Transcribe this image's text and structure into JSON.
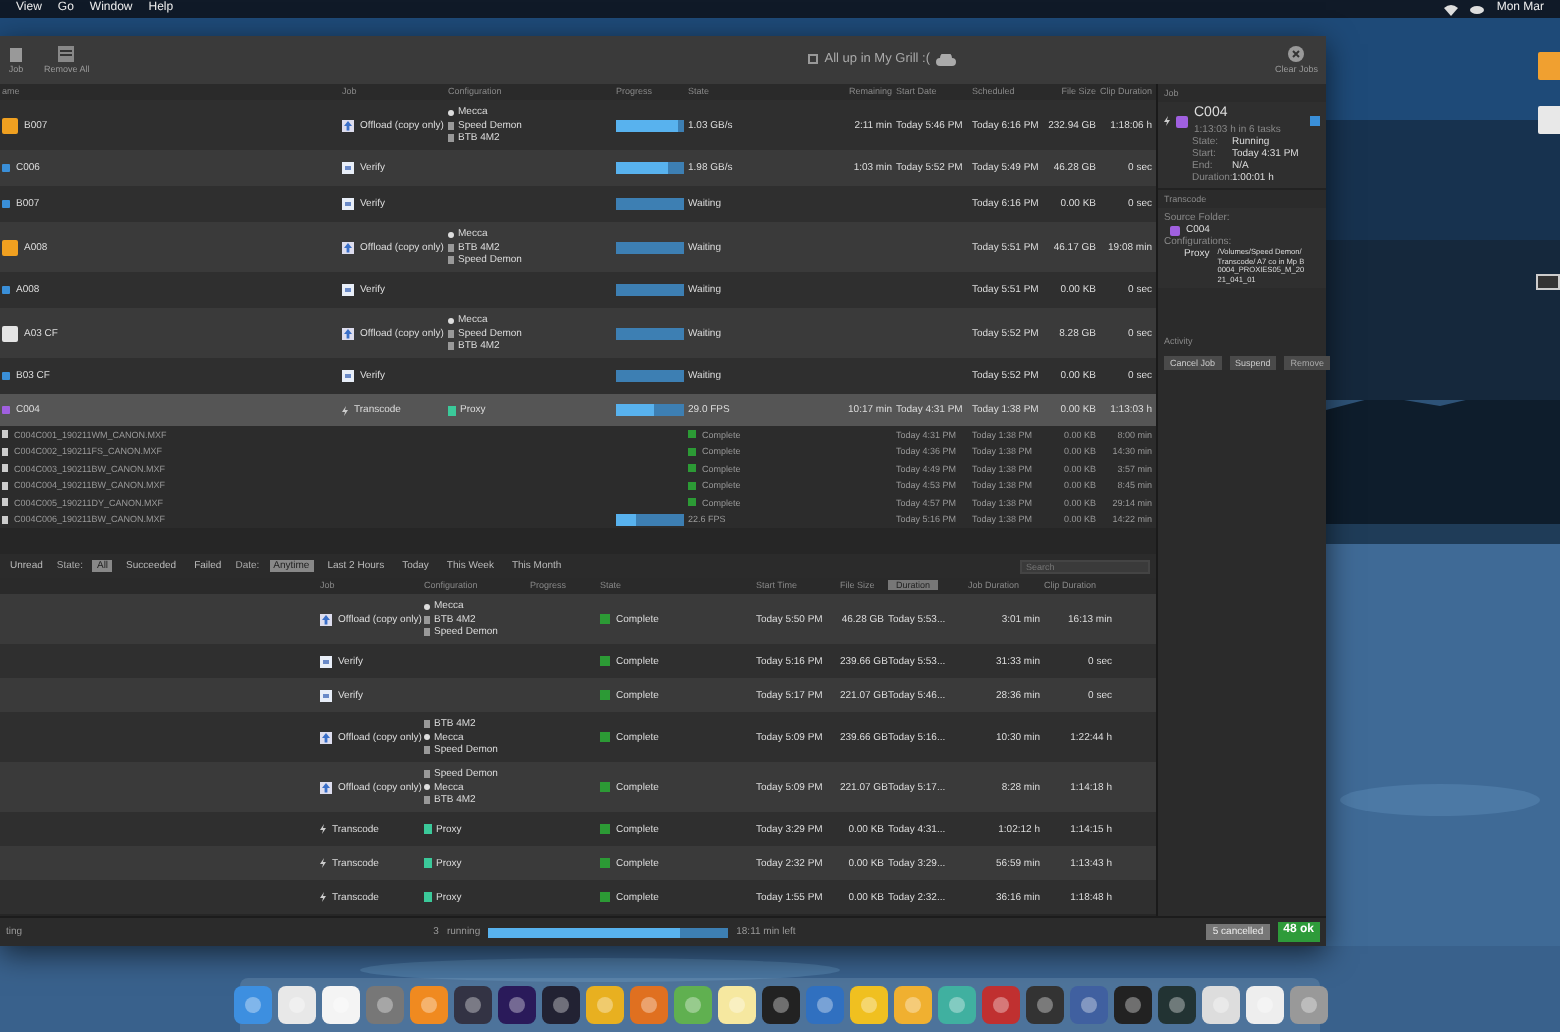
{
  "menu_bar": {
    "items": [
      "View",
      "Go",
      "Window",
      "Help"
    ],
    "clock": "Mon Mar"
  },
  "toolbar": {
    "buttons": [
      "Job",
      "Remove All"
    ],
    "title": "All up in My Grill :(",
    "clear": "Clear Jobs"
  },
  "queue": {
    "columns": [
      "ame",
      "Job",
      "Configuration",
      "Progress",
      "State",
      "Remaining",
      "Start Date",
      "Scheduled",
      "File Size",
      "Clip Duration"
    ],
    "rows": [
      {
        "name": "B007",
        "kind": "offload",
        "color": "#f0a020",
        "job": "Offload (copy only)",
        "destinations": [
          {
            "name": "Mecca",
            "kind": "network"
          },
          {
            "name": "Speed Demon",
            "kind": "drive"
          },
          {
            "name": "BTB 4M2",
            "kind": "drive"
          }
        ],
        "level": 0.9,
        "state": "1.03 GB/s",
        "remaining": "2:11 min",
        "start": "Today 5:46 PM",
        "scheduled": "Today 6:16 PM",
        "size": "232.94 GB",
        "duration": "1:18:06 h",
        "selected": false
      },
      {
        "name": "C006",
        "kind": "verify",
        "color": "#3a8fd8",
        "job": "Verify",
        "destinations": [],
        "level": 0.75,
        "state": "1.98 GB/s",
        "remaining": "1:03 min",
        "start": "Today 5:52 PM",
        "scheduled": "Today 5:49 PM",
        "size": "46.28 GB",
        "duration": "0 sec",
        "selected": false
      },
      {
        "name": "B007",
        "kind": "verify",
        "color": "#3a8fd8",
        "job": "Verify",
        "destinations": [],
        "state": "Waiting",
        "scheduled": "Today 6:16 PM",
        "size": "0.00 KB",
        "duration": "0 sec",
        "selected": false
      },
      {
        "name": "A008",
        "kind": "offload",
        "color": "#f0a020",
        "job": "Offload (copy only)",
        "destinations": [
          {
            "name": "Mecca",
            "kind": "network"
          },
          {
            "name": "BTB 4M2",
            "kind": "drive"
          },
          {
            "name": "Speed Demon",
            "kind": "drive"
          }
        ],
        "state": "Waiting",
        "scheduled": "Today 5:51 PM",
        "size": "46.17 GB",
        "duration": "19:08 min",
        "selected": false
      },
      {
        "name": "A008",
        "kind": "verify",
        "color": "#3a8fd8",
        "job": "Verify",
        "destinations": [],
        "state": "Waiting",
        "scheduled": "Today 5:51 PM",
        "size": "0.00 KB",
        "duration": "0 sec",
        "selected": false
      },
      {
        "name": "A03 CF",
        "kind": "offload",
        "color": "#e4e4e4",
        "job": "Offload (copy only)",
        "destinations": [
          {
            "name": "Mecca",
            "kind": "network"
          },
          {
            "name": "Speed Demon",
            "kind": "drive"
          },
          {
            "name": "BTB 4M2",
            "kind": "drive"
          }
        ],
        "state": "Waiting",
        "scheduled": "Today 5:52 PM",
        "size": "8.28 GB",
        "duration": "0 sec",
        "selected": false
      },
      {
        "name": "B03 CF",
        "kind": "verify",
        "color": "#3a8fd8",
        "job": "Verify",
        "destinations": [],
        "state": "Waiting",
        "scheduled": "Today 5:52 PM",
        "size": "0.00 KB",
        "duration": "0 sec",
        "selected": false
      },
      {
        "name": "C004",
        "kind": "transcode",
        "color": "#a060e0",
        "job": "Transcode",
        "destinations": [
          {
            "name": "Proxy",
            "kind": "preset"
          }
        ],
        "level": 0.55,
        "state": "29.0 FPS",
        "remaining": "10:17 min",
        "start": "Today 4:31 PM",
        "scheduled": "Today 1:38 PM",
        "size": "0.00 KB",
        "duration": "1:13:03 h",
        "selected": true,
        "children": [
          {
            "name": "C004C001_190211WM_CANON.MXF",
            "done": true,
            "state": "Complete",
            "start": "Today 4:31 PM",
            "scheduled": "Today 1:38 PM",
            "size": "0.00 KB",
            "duration": "8:00 min"
          },
          {
            "name": "C004C002_190211FS_CANON.MXF",
            "done": true,
            "state": "Complete",
            "start": "Today 4:36 PM",
            "scheduled": "Today 1:38 PM",
            "size": "0.00 KB",
            "duration": "14:30 min"
          },
          {
            "name": "C004C003_190211BW_CANON.MXF",
            "done": true,
            "state": "Complete",
            "start": "Today 4:49 PM",
            "scheduled": "Today 1:38 PM",
            "size": "0.00 KB",
            "duration": "3:57 min"
          },
          {
            "name": "C004C004_190211BW_CANON.MXF",
            "done": true,
            "state": "Complete",
            "start": "Today 4:53 PM",
            "scheduled": "Today 1:38 PM",
            "size": "0.00 KB",
            "duration": "8:45 min"
          },
          {
            "name": "C004C005_190211DY_CANON.MXF",
            "done": true,
            "state": "Complete",
            "start": "Today 4:57 PM",
            "scheduled": "Today 1:38 PM",
            "size": "0.00 KB",
            "duration": "29:14 min"
          },
          {
            "name": "C004C006_190211BW_CANON.MXF",
            "done": false,
            "level": 0.3,
            "state": "22.6 FPS",
            "start": "Today 5:16 PM",
            "scheduled": "Today 1:38 PM",
            "size": "0.00 KB",
            "duration": "14:22 min"
          }
        ]
      }
    ]
  },
  "inspector": {
    "header": "Job",
    "name": "C004",
    "summary": "1:13:03 h in 6 tasks",
    "fields": [
      {
        "label": "State:",
        "value": "Running"
      },
      {
        "label": "Start:",
        "value": "Today 4:31 PM"
      },
      {
        "label": "End:",
        "value": "N/A"
      },
      {
        "label": "Duration:",
        "value": "1:00:01 h"
      }
    ],
    "section": "Transcode",
    "source_label": "Source Folder:",
    "source": "C004",
    "config_label": "Configurations:",
    "config_name": "Proxy",
    "config_path": "/Volumes/Speed Demon/Transcode/ A7 co in Mp B0004_PROXIES05_M_2021_041_01",
    "activity": "Activity",
    "buttons": [
      "Cancel Job",
      "Suspend",
      "Remove"
    ]
  },
  "filter": {
    "unread": "Unread",
    "state_label": "State:",
    "states": [
      {
        "label": "All",
        "selected": true
      },
      {
        "label": "Succeeded",
        "selected": false
      },
      {
        "label": "Failed",
        "selected": false
      }
    ],
    "date_label": "Date:",
    "dates": [
      {
        "label": "Anytime",
        "selected": true
      },
      {
        "label": "Last 2 Hours",
        "selected": false
      },
      {
        "label": "Today",
        "selected": false
      },
      {
        "label": "This Week",
        "selected": false
      },
      {
        "label": "This Month",
        "selected": false
      }
    ],
    "search_placeholder": "Search"
  },
  "history": {
    "columns": [
      "Job",
      "Configuration",
      "Progress",
      "State",
      "Start Time",
      "File Size",
      "Duration",
      "Job Duration",
      "Clip Duration"
    ],
    "rows": [
      {
        "kind": "offload",
        "job": "Offload (copy only)",
        "destinations": [
          {
            "name": "Mecca",
            "kind": "network"
          },
          {
            "name": "BTB 4M2",
            "kind": "drive"
          },
          {
            "name": "Speed Demon",
            "kind": "drive"
          }
        ],
        "state": "Complete",
        "start": "Today 5:50 PM",
        "size": "46.28 GB",
        "end": "Today 5:53...",
        "job_duration": "3:01 min",
        "clip_duration": "16:13 min"
      },
      {
        "kind": "verify",
        "job": "Verify",
        "destinations": [],
        "state": "Complete",
        "start": "Today 5:16 PM",
        "size": "239.66 GB",
        "end": "Today 5:53...",
        "job_duration": "31:33 min",
        "clip_duration": "0 sec"
      },
      {
        "kind": "verify",
        "job": "Verify",
        "destinations": [],
        "state": "Complete",
        "start": "Today 5:17 PM",
        "size": "221.07 GB",
        "end": "Today 5:46...",
        "job_duration": "28:36 min",
        "clip_duration": "0 sec"
      },
      {
        "kind": "offload",
        "job": "Offload (copy only)",
        "destinations": [
          {
            "name": "BTB 4M2",
            "kind": "drive"
          },
          {
            "name": "Mecca",
            "kind": "network"
          },
          {
            "name": "Speed Demon",
            "kind": "drive"
          }
        ],
        "state": "Complete",
        "start": "Today 5:09 PM",
        "size": "239.66 GB",
        "end": "Today 5:16...",
        "job_duration": "10:30 min",
        "clip_duration": "1:22:44 h"
      },
      {
        "kind": "offload",
        "job": "Offload (copy only)",
        "destinations": [
          {
            "name": "Speed Demon",
            "kind": "drive"
          },
          {
            "name": "Mecca",
            "kind": "network"
          },
          {
            "name": "BTB 4M2",
            "kind": "drive"
          }
        ],
        "state": "Complete",
        "start": "Today 5:09 PM",
        "size": "221.07 GB",
        "end": "Today 5:17...",
        "job_duration": "8:28 min",
        "clip_duration": "1:14:18 h"
      },
      {
        "kind": "transcode",
        "job": "Transcode",
        "destinations": [
          {
            "name": "Proxy",
            "kind": "preset"
          }
        ],
        "state": "Complete",
        "start": "Today 3:29 PM",
        "size": "0.00 KB",
        "end": "Today 4:31...",
        "job_duration": "1:02:12 h",
        "clip_duration": "1:14:15 h"
      },
      {
        "kind": "transcode",
        "job": "Transcode",
        "destinations": [
          {
            "name": "Proxy",
            "kind": "preset"
          }
        ],
        "state": "Complete",
        "start": "Today 2:32 PM",
        "size": "0.00 KB",
        "end": "Today 3:29...",
        "job_duration": "56:59 min",
        "clip_duration": "1:13:43 h"
      },
      {
        "kind": "transcode",
        "job": "Transcode",
        "destinations": [
          {
            "name": "Proxy",
            "kind": "preset"
          }
        ],
        "state": "Complete",
        "start": "Today 1:55 PM",
        "size": "0.00 KB",
        "end": "Today 2:32...",
        "job_duration": "36:16 min",
        "clip_duration": "1:18:48 h"
      }
    ]
  },
  "status_bar": {
    "left": "ting",
    "running_count": "3",
    "running": "running",
    "level": 0.8,
    "time_left": "18:11 min left",
    "cancelled_count": "5",
    "cancelled": "cancelled",
    "ok_count": "48",
    "ok": "ok"
  }
}
